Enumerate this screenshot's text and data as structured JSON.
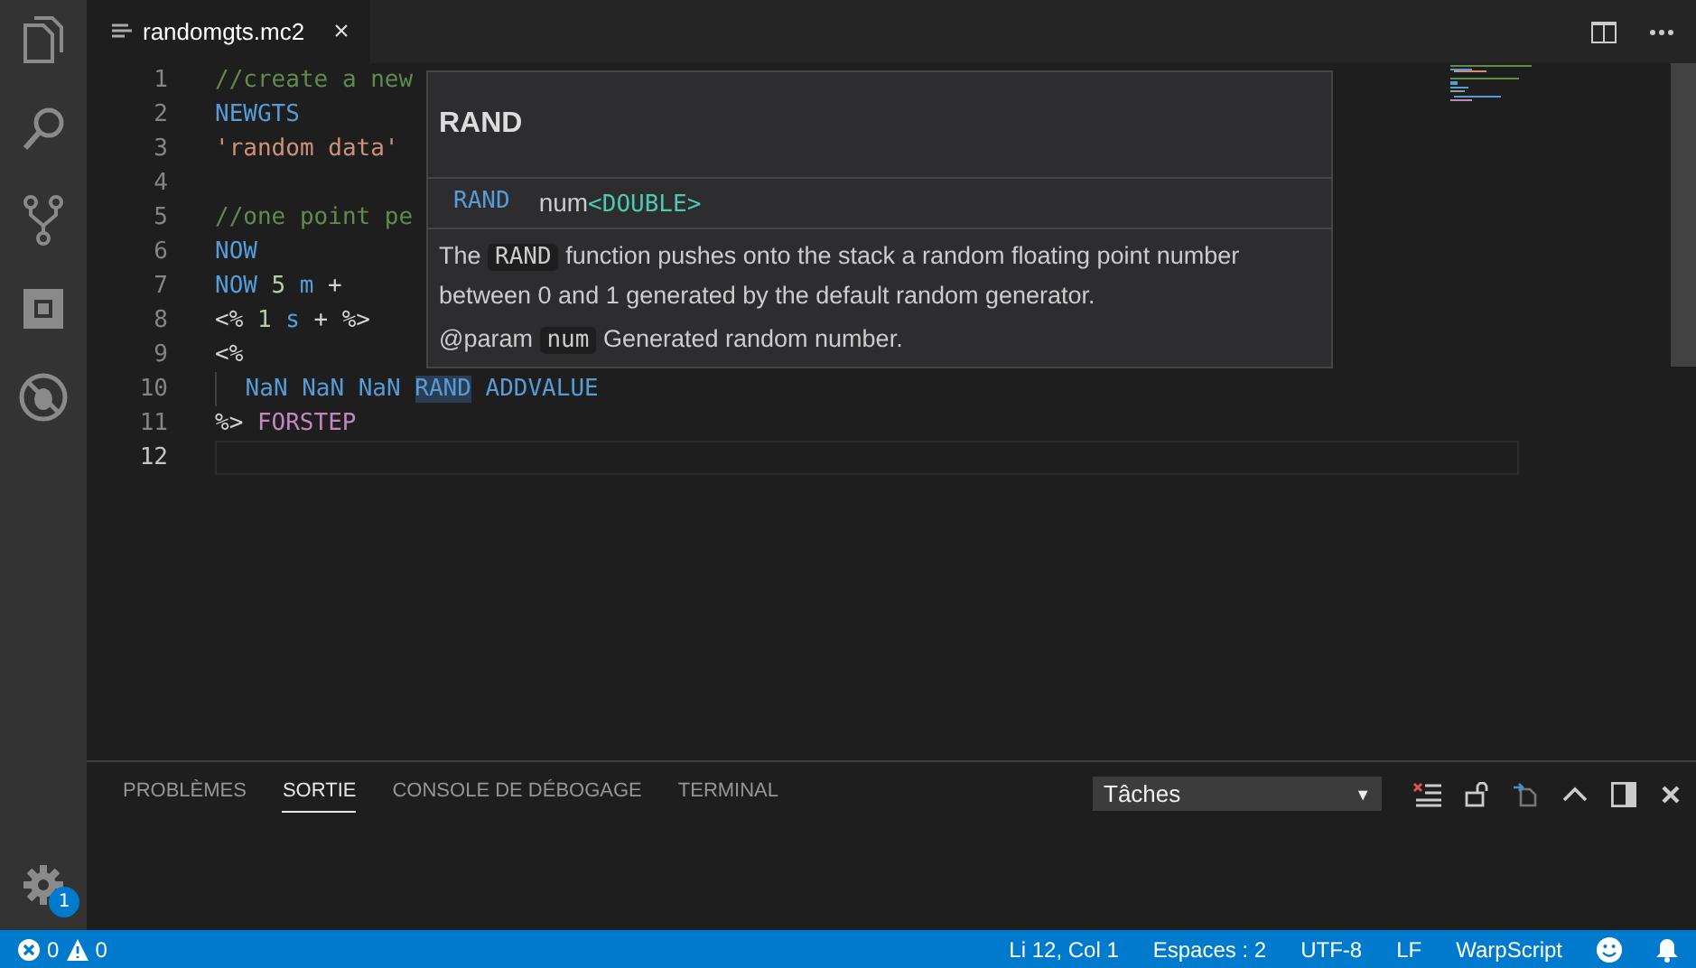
{
  "tabs": [
    {
      "label": "randomgts.mc2",
      "selected": true,
      "close": "×"
    }
  ],
  "code": [
    {
      "number": "1",
      "current": false,
      "tokens": [
        {
          "kind": "comment",
          "text": "//create a new"
        }
      ]
    },
    {
      "number": "2",
      "current": false,
      "tokens": [
        {
          "kind": "keyword",
          "text": "NEWGTS"
        }
      ]
    },
    {
      "number": "3",
      "current": false,
      "tokens": [
        {
          "kind": "string",
          "text": "'random data'"
        }
      ]
    },
    {
      "number": "4",
      "current": false
    },
    {
      "number": "5",
      "current": false,
      "tokens": [
        {
          "kind": "comment",
          "text": "//one point pe"
        }
      ]
    },
    {
      "number": "6",
      "current": false,
      "tokens": [
        {
          "kind": "keyword",
          "text": "NOW"
        }
      ]
    },
    {
      "number": "7",
      "current": false,
      "tokens": [
        {
          "kind": "keyword",
          "text": "NOW"
        },
        {
          "kind": "number",
          "text": "5"
        },
        {
          "kind": "keyword",
          "text": "m"
        },
        {
          "kind": "plain",
          "text": "+"
        }
      ]
    },
    {
      "number": "8",
      "current": false,
      "tokens": [
        {
          "kind": "plain",
          "text": "<%"
        },
        {
          "kind": "number",
          "text": "1"
        },
        {
          "kind": "keyword",
          "text": "s"
        },
        {
          "kind": "plain",
          "text": "+"
        },
        {
          "kind": "plain",
          "text": "%>"
        }
      ]
    },
    {
      "number": "9",
      "current": false,
      "tokens": [
        {
          "kind": "plain",
          "text": "<%"
        }
      ]
    },
    {
      "number": "10",
      "current": false,
      "indent": true,
      "tokens": [
        {
          "kind": "keyword",
          "text": "NaN"
        },
        {
          "kind": "keyword",
          "text": "NaN"
        },
        {
          "kind": "keyword",
          "text": "NaN"
        },
        {
          "kind": "highlight",
          "text": "RAND"
        },
        {
          "kind": "keyword",
          "text": "ADDVALUE"
        }
      ]
    },
    {
      "number": "11",
      "current": false,
      "tokens": [
        {
          "kind": "plain",
          "text": "%>"
        },
        {
          "kind": "control",
          "text": "FORSTEP"
        }
      ]
    },
    {
      "number": "12",
      "current": true
    }
  ],
  "hover": {
    "title": "RAND",
    "signature": {
      "name": "RAND",
      "param": "num",
      "type": "<DOUBLE>"
    },
    "description": [
      {
        "kind": "text",
        "text": "The"
      },
      {
        "kind": "code",
        "text": "RAND"
      },
      {
        "kind": "text",
        "text": "function pushes onto the stack a random floating point number between 0 and 1 generated by the default random generator."
      }
    ],
    "param_tag": "@param",
    "param_name": "num",
    "param_text": "Generated random number."
  },
  "panel": {
    "tabs": [
      {
        "label": "PROBLÈMES",
        "selected": false
      },
      {
        "label": "SORTIE",
        "selected": true
      },
      {
        "label": "CONSOLE DE DÉBOGAGE",
        "selected": false
      },
      {
        "label": "TERMINAL",
        "selected": false
      }
    ],
    "dropdown": {
      "value": "Tâches",
      "caret": "▼"
    }
  },
  "activity_badge": "1",
  "status_bar": {
    "errors": "0",
    "warnings": "0",
    "items": [
      "Li 12, Col 1",
      "Espaces : 2",
      "UTF-8",
      "LF",
      "WarpScript"
    ]
  }
}
